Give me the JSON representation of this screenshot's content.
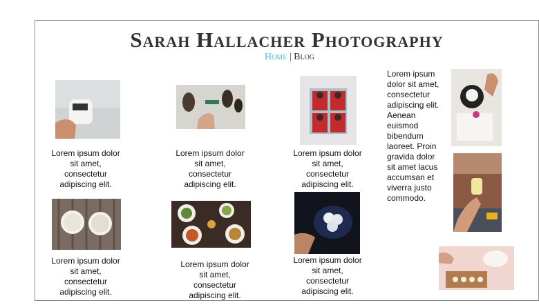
{
  "site": {
    "title": "Sarah Hallacher Photography",
    "nav": {
      "home": "Home",
      "separator": "|",
      "blog": "Blog"
    }
  },
  "gallery": {
    "captions": [
      "Lorem ipsum dolor sit amet, consectetur adipiscing elit.",
      "Lorem ipsum dolor sit amet, consectetur adipiscing elit.",
      "Lorem ipsum dolor sit amet, consectetur adipiscing elit.",
      "Lorem ipsum dolor sit amet, consectetur adipiscing elit.",
      "Lorem ipsum dolor sit amet, consectetur adipiscing elit.",
      "Lorem ipsum dolor sit amet, consectetur adipiscing elit."
    ],
    "side_text": "Lorem ipsum dolor sit amet, consectetur adipiscing elit. Aenean euismod bibendum laoreet. Proin gravida dolor sit amet lacus accumsan et viverra justo commodo."
  },
  "colors": {
    "accent": "#3cc6d8",
    "border": "#8a8a8a"
  }
}
